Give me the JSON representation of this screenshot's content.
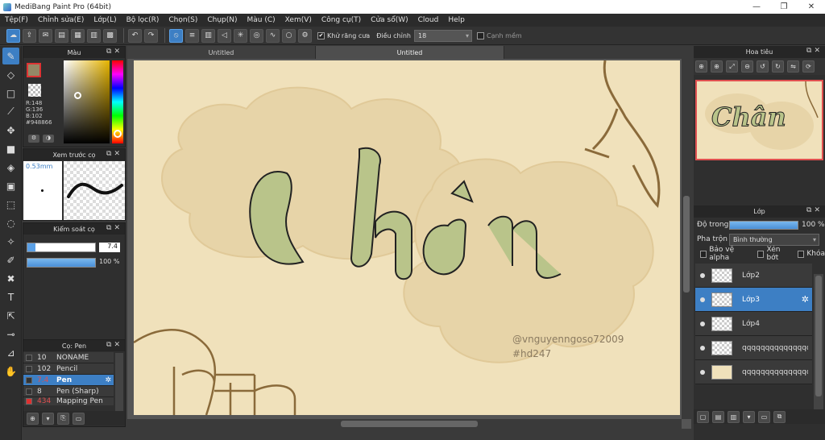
{
  "window": {
    "title": "MediBang Paint Pro (64bit)",
    "min": "—",
    "max": "❐",
    "close": "✕"
  },
  "menu": [
    "Tệp(F)",
    "Chỉnh sửa(E)",
    "Lớp(L)",
    "Bộ lọc(R)",
    "Chọn(S)",
    "Chụp(N)",
    "Màu (C)",
    "Xem(V)",
    "Công cụ(T)",
    "Cửa sổ(W)",
    "Cloud",
    "Help"
  ],
  "toolbar": {
    "antialias_label": "Khử răng cưa",
    "antialias_checked": true,
    "correction_label": "Điều chỉnh",
    "correction_value": "18",
    "sharp_edge_label": "Cạnh mềm",
    "sharp_edge_checked": false
  },
  "color_panel": {
    "title": "Màu",
    "r": "R:148",
    "g": "G:136",
    "b": "B:102",
    "hex": "#948866",
    "fg_color": "#948866"
  },
  "brush_preview": {
    "title": "Xem trước cọ",
    "size": "0.53mm"
  },
  "brush_control": {
    "title": "Kiểm soát cọ",
    "size_value": "7.4",
    "opacity_value": "100 %",
    "size_fraction": 0.9,
    "opacity_fraction": 1.0
  },
  "brush_list": {
    "title": "Cọ: Pen",
    "items": [
      {
        "size": "10",
        "name": "NONAME",
        "color": "#333333"
      },
      {
        "size": "102",
        "name": "Pencil",
        "color": "#333333"
      },
      {
        "size": "7.4",
        "name": "Pen",
        "color": "#333333",
        "selected": true
      },
      {
        "size": "8",
        "name": "Pen (Sharp)",
        "color": "#333333"
      },
      {
        "size": "434",
        "name": "Mapping Pen",
        "color": "#e03030"
      }
    ]
  },
  "tabs": [
    "Untitled",
    "Untitled"
  ],
  "canvas": {
    "bg": "#f0e1bb",
    "lettering": "Chân",
    "watermark_line1": "@vnguyenngoso72009",
    "watermark_line2": "#hd247"
  },
  "navigator": {
    "title": "Hoa tiêu"
  },
  "layer_panel": {
    "title": "Lớp",
    "opacity_label": "Độ trong",
    "opacity_value": "100 %",
    "opacity_fraction": 1.0,
    "blend_label": "Pha trộn",
    "blend_value": "Bình thường",
    "protect_alpha": "Bảo vệ alpha",
    "clipping": "Xén bớt",
    "lock": "Khóa",
    "layers": [
      {
        "name": "Lớp2",
        "selected": false
      },
      {
        "name": "Lớp3",
        "selected": true
      },
      {
        "name": "Lớp4",
        "selected": false
      },
      {
        "name": "qqqqqqqqqqqqqqq",
        "selected": false
      },
      {
        "name": "qqqqqqqqqqqqqqq",
        "selected": false
      }
    ]
  },
  "accent_color": "#3d7fc4"
}
